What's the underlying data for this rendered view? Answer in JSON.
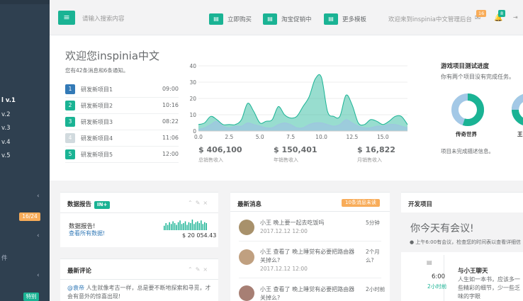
{
  "sidebar": {
    "items": [
      {
        "label": "l v.1",
        "active": true
      },
      {
        "label": "v.2"
      },
      {
        "label": "v.3"
      },
      {
        "label": "v.4"
      },
      {
        "label": "v.5"
      }
    ],
    "badge_orange": "16/24",
    "side_char": "件",
    "badge_green": "特别"
  },
  "header": {
    "search_placeholder": "请输入搜索内容",
    "btn_buy": "立即购买",
    "btn_taobao": "淘宝促销中",
    "btn_templates": "更多模板",
    "welcome": "欢迎来到inspinia中文管理后台",
    "mail_count": "16",
    "bell_count": "8"
  },
  "top": {
    "title": "欢迎您inspinia中文",
    "subtitle": "您有42条消息和6条通知。",
    "projects": [
      {
        "num": "1",
        "name": "研发新项目1",
        "time": "09:00",
        "color": "#337ab7"
      },
      {
        "num": "2",
        "name": "研发新项目2",
        "time": "10:16",
        "color": "#1ab394"
      },
      {
        "num": "3",
        "name": "研发新项目3",
        "time": "08:22",
        "color": "#1ab394"
      },
      {
        "num": "4",
        "name": "研发新项目4",
        "time": "11:06",
        "color": "#d1dade"
      },
      {
        "num": "5",
        "name": "研发新项目5",
        "time": "12:00",
        "color": "#1ab394"
      }
    ],
    "stats": [
      {
        "value": "$ 406,100",
        "label": "总销售收入"
      },
      {
        "value": "$ 150,401",
        "label": "年销售收入"
      },
      {
        "value": "$ 16,822",
        "label": "月销售收入"
      }
    ],
    "progress_title": "游戏项目测试进度",
    "progress_sub": "你有两个项目没有完成任务。",
    "donut_label": "传奇世界",
    "donut_label2": "王",
    "progress_note": "项目未完成描述信息。"
  },
  "chart_data": {
    "type": "area",
    "x": [
      0,
      0.5,
      1,
      1.5,
      2,
      2.5,
      3,
      3.5,
      4,
      4.5,
      5,
      5.5,
      6,
      6.5,
      7,
      7.5,
      8,
      8.5,
      9,
      9.5,
      10,
      10.5,
      11,
      11.5,
      12,
      12.5,
      13,
      13.5,
      14,
      14.5,
      15,
      15.5,
      16,
      16.5,
      17
    ],
    "series": [
      {
        "values": [
          4,
          5,
          9,
          7,
          4,
          4,
          4,
          7,
          17,
          12,
          5,
          6,
          7,
          15,
          10,
          8,
          9,
          15,
          21,
          32,
          33,
          12,
          9,
          9,
          22,
          16,
          5,
          4,
          7,
          6,
          4,
          6,
          9,
          9,
          4
        ],
        "color": "#1ab394"
      },
      {
        "values": [
          1,
          2,
          4,
          6,
          3,
          2,
          3,
          3,
          5,
          4,
          3,
          2,
          2,
          4,
          5,
          4,
          2,
          2,
          4,
          5,
          5,
          4,
          3,
          4,
          7,
          5,
          3,
          2,
          2,
          3,
          3,
          4,
          4,
          3,
          2
        ],
        "color": "#9ec5e0"
      }
    ],
    "xlim": [
      0,
      17
    ],
    "ylim": [
      0,
      40
    ],
    "xticks": [
      "0.0",
      "2.5",
      "5.0",
      "7.5",
      "10.0",
      "12.5",
      "15.0"
    ],
    "yticks": [
      "0",
      "10",
      "20",
      "30",
      "40"
    ]
  },
  "donut": {
    "segments": [
      0.55,
      0.45
    ],
    "colors": [
      "#1ab394",
      "#a3c8e6"
    ]
  },
  "data_report": {
    "title": "数据报告",
    "tag": "IN+",
    "heading": "数据报告!",
    "link": "查看所有数据!",
    "amount": "$ 20 054.43"
  },
  "sparkline": [
    5,
    8,
    6,
    9,
    7,
    10,
    8,
    6,
    9,
    11,
    7,
    8,
    10,
    6,
    9,
    8,
    12,
    7,
    9,
    10,
    8,
    11,
    7,
    9,
    8
  ],
  "comments": {
    "title": "最新评论",
    "text_user": "@袁帝",
    "text": "人生就像考古一样，总是要不断地探索和寻觅，才会有意外的惊喜出现!"
  },
  "messages": {
    "title": "最新消息",
    "badge": "10条消息未读",
    "items": [
      {
        "text": "小王 晚上要一起去吃饭吗",
        "date": "2017.12.12 12:00",
        "ago": "5分钟"
      },
      {
        "text": "小王 查看了 晚上睡觉有必要把路由器关掉么?",
        "date": "2017.12.12 12:00",
        "ago": "2个月么?"
      },
      {
        "text": "小王 查看了 晚上睡觉有必要把路由器关掉么?",
        "date": "2017.12.12 12:00",
        "ago": "2小时前"
      }
    ]
  },
  "dev": {
    "title": "开发项目",
    "meeting": "你今天有会议!",
    "meeting_sub": "上午6:00有会议，检查您的时间表以查看详细信",
    "event_time": "6:00",
    "event_ago": "2小时前",
    "event_title": "与小王聊天",
    "event_body": "人生如一本书，应该多一些精彩的细节，少一些乏味的字眼"
  }
}
